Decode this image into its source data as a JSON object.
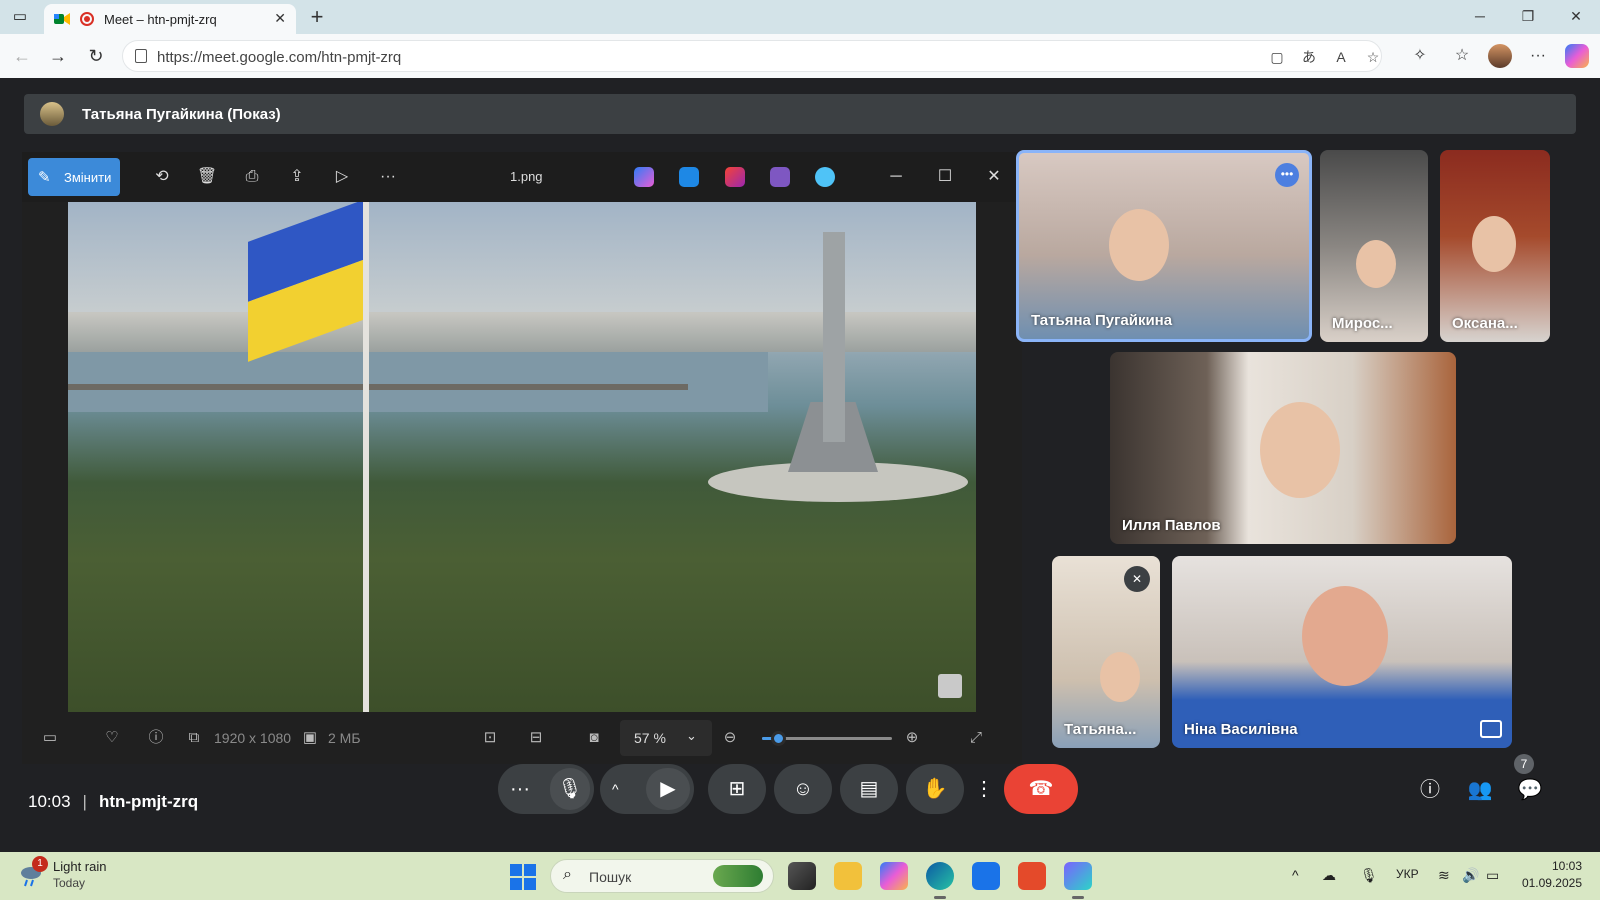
{
  "browser": {
    "tab_title": "Meet – htn-pmjt-zrq",
    "url": "https://meet.google.com/htn-pmjt-zrq"
  },
  "meet": {
    "presenter_label": "Татьяна Пугайкина (Показ)",
    "time": "10:03",
    "meeting_code": "htn-pmjt-zrq",
    "participant_count": "7"
  },
  "viewer": {
    "edit_label": "Змінити",
    "file_name": "1.png",
    "dimensions": "1920 x 1080",
    "file_size": "2 МБ",
    "zoom": "57 %",
    "zoom_fraction": 0.12
  },
  "participants": [
    {
      "name": "Татьяна Пугайкина",
      "state": "active-speaker"
    },
    {
      "name": "Мирос..."
    },
    {
      "name": "Оксана..."
    },
    {
      "name": "Илля Павлов"
    },
    {
      "name": "Татьяна...",
      "state": "muted"
    },
    {
      "name": "Ніна Василівна"
    }
  ],
  "taskbar": {
    "weather_main": "Light rain",
    "weather_sub": "Today",
    "weather_badge": "1",
    "search_placeholder": "Пошук",
    "lang": "УКР",
    "time": "10:03",
    "date": "01.09.2025"
  },
  "colors": {
    "accent": "#3c8ad9",
    "end_call": "#ea4335",
    "active_tile_border": "#8ab4f8"
  }
}
